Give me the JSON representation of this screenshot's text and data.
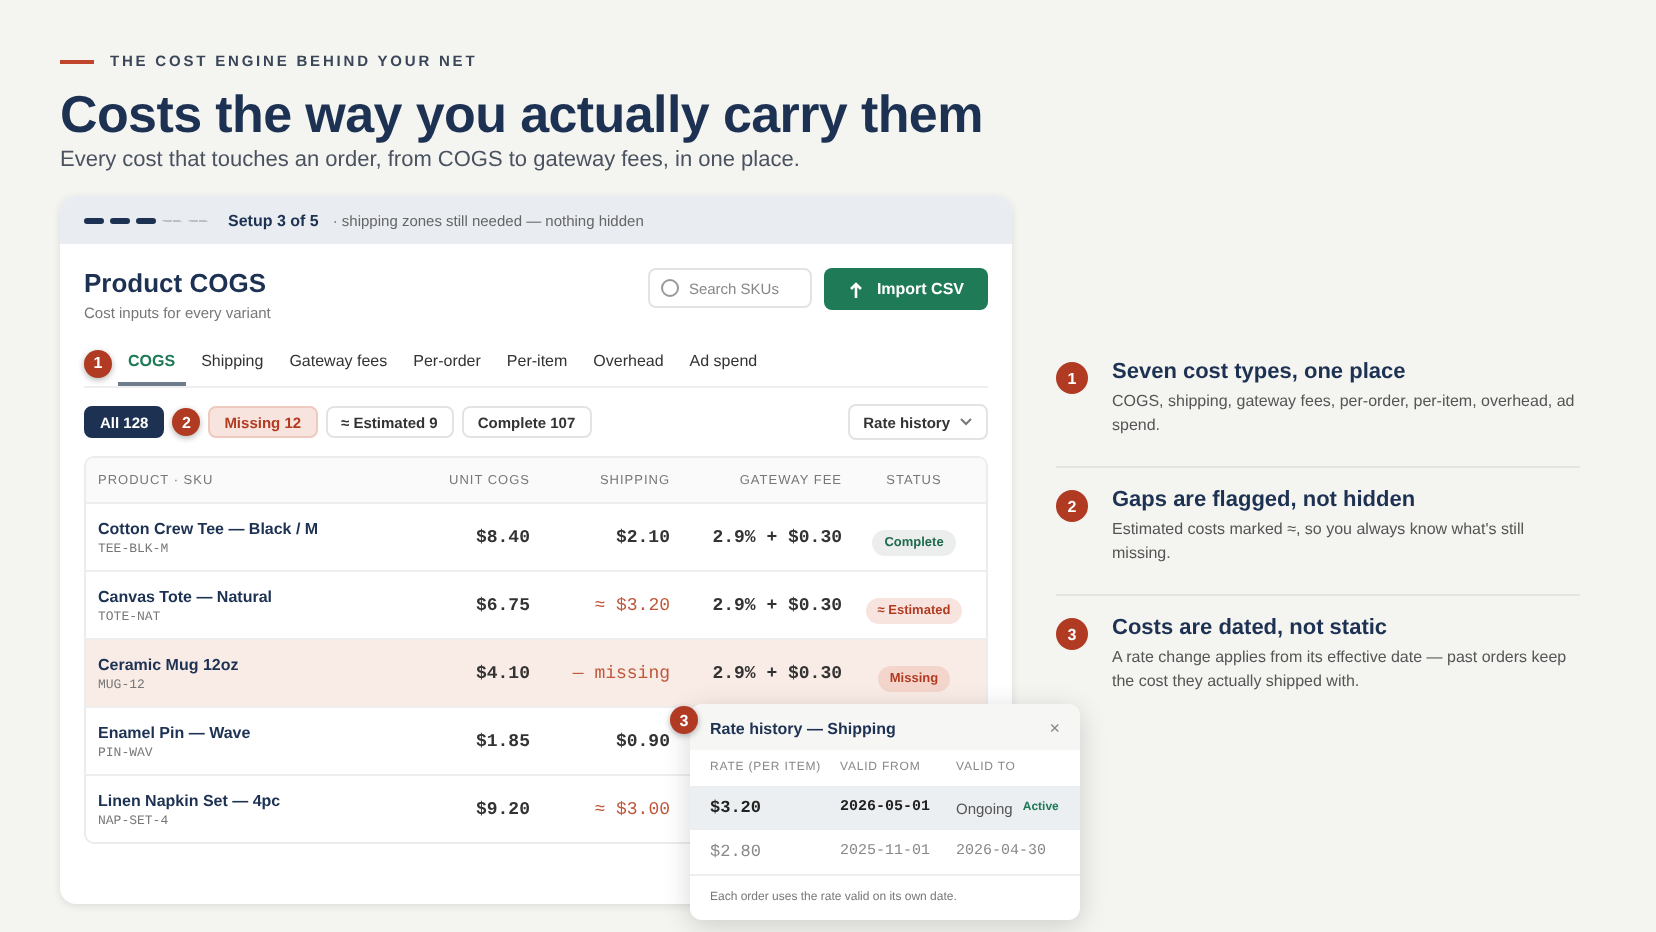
{
  "eyebrow": "THE COST ENGINE BEHIND YOUR NET",
  "title": "Costs the way you actually carry them",
  "subtitle": "Every cost that touches an order, from COGS to gateway fees, in one place.",
  "setup": {
    "steps": [
      {
        "done": true
      },
      {
        "done": true
      },
      {
        "done": true
      },
      {
        "done": false
      },
      {
        "done": false
      }
    ],
    "label": "Setup 3 of 5",
    "note": "· shipping zones still needed — nothing hidden"
  },
  "panel": {
    "title": "Product COGS",
    "subtitle": "Cost inputs for every variant",
    "search": {
      "placeholder": "Search SKUs"
    },
    "import_button": "Import CSV",
    "tab_marker": "1",
    "tabs": [
      {
        "label": "COGS",
        "selected": true
      },
      {
        "label": "Shipping",
        "selected": false
      },
      {
        "label": "Gateway fees",
        "selected": false
      },
      {
        "label": "Per-order",
        "selected": false
      },
      {
        "label": "Per-item",
        "selected": false
      },
      {
        "label": "Overhead",
        "selected": false
      },
      {
        "label": "Ad spend",
        "selected": false
      }
    ],
    "filter_marker": "2",
    "filters": [
      {
        "label": "All 128",
        "kind": "all",
        "selected": true
      },
      {
        "label": "Missing 12",
        "kind": "missing",
        "selected": false
      },
      {
        "label": "≈ Estimated 9",
        "kind": "plain",
        "selected": false
      },
      {
        "label": "Complete 107",
        "kind": "plain",
        "selected": false
      }
    ],
    "rate_history_button": "Rate history",
    "table": {
      "columns": [
        "PRODUCT · SKU",
        "UNIT COGS",
        "SHIPPING",
        "GATEWAY FEE",
        "STATUS"
      ],
      "rows": [
        {
          "product": "Cotton Crew Tee — Black / M",
          "sku": "TEE-BLK-M",
          "unit_cogs": "$8.40",
          "shipping": {
            "text": "$2.10",
            "kind": "normal"
          },
          "gateway_fee": "2.9% + $0.30",
          "status": {
            "label": "Complete",
            "kind": "complete"
          },
          "highlighted": false
        },
        {
          "product": "Canvas Tote — Natural",
          "sku": "TOTE-NAT",
          "unit_cogs": "$6.75",
          "shipping": {
            "text": "≈ $3.20",
            "kind": "estimated"
          },
          "gateway_fee": "2.9% + $0.30",
          "status": {
            "label": "≈ Estimated",
            "kind": "estimated"
          },
          "highlighted": false
        },
        {
          "product": "Ceramic Mug 12oz",
          "sku": "MUG-12",
          "unit_cogs": "$4.10",
          "shipping": {
            "text": "— missing",
            "kind": "missing"
          },
          "gateway_fee": "2.9% + $0.30",
          "status": {
            "label": "Missing",
            "kind": "missing"
          },
          "highlighted": true
        },
        {
          "product": "Enamel Pin — Wave",
          "sku": "PIN-WAV",
          "unit_cogs": "$1.85",
          "shipping": {
            "text": "$0.90",
            "kind": "normal"
          },
          "highlighted": false
        },
        {
          "product": "Linen Napkin Set — 4pc",
          "sku": "NAP-SET-4",
          "unit_cogs": "$9.20",
          "shipping": {
            "text": "≈ $3.00",
            "kind": "estimated"
          },
          "highlighted": false
        }
      ]
    }
  },
  "popup": {
    "marker": "3",
    "title": "Rate history — Shipping",
    "close": "×",
    "columns": [
      "RATE (PER ITEM)",
      "VALID FROM",
      "VALID TO"
    ],
    "rows": [
      {
        "rate": "$3.20",
        "valid_from": "2026-05-01",
        "valid_to": "Ongoing",
        "badge": "Active",
        "selected": true
      },
      {
        "rate": "$2.80",
        "valid_from": "2025-11-01",
        "valid_to": "2026-04-30",
        "selected": false
      }
    ],
    "note": "Each order uses the rate valid on its own date."
  },
  "features": [
    {
      "number": "1",
      "title": "Seven cost types, one place",
      "text": "COGS, shipping, gateway fees, per-order, per-item, overhead, ad spend."
    },
    {
      "number": "2",
      "title": "Gaps are flagged, not hidden",
      "text": "Estimated costs marked ≈, so you always know what's still missing."
    },
    {
      "number": "3",
      "title": "Costs are dated, not static",
      "text": "A rate change applies from its effective date — past orders keep the cost they actually shipped with."
    }
  ]
}
